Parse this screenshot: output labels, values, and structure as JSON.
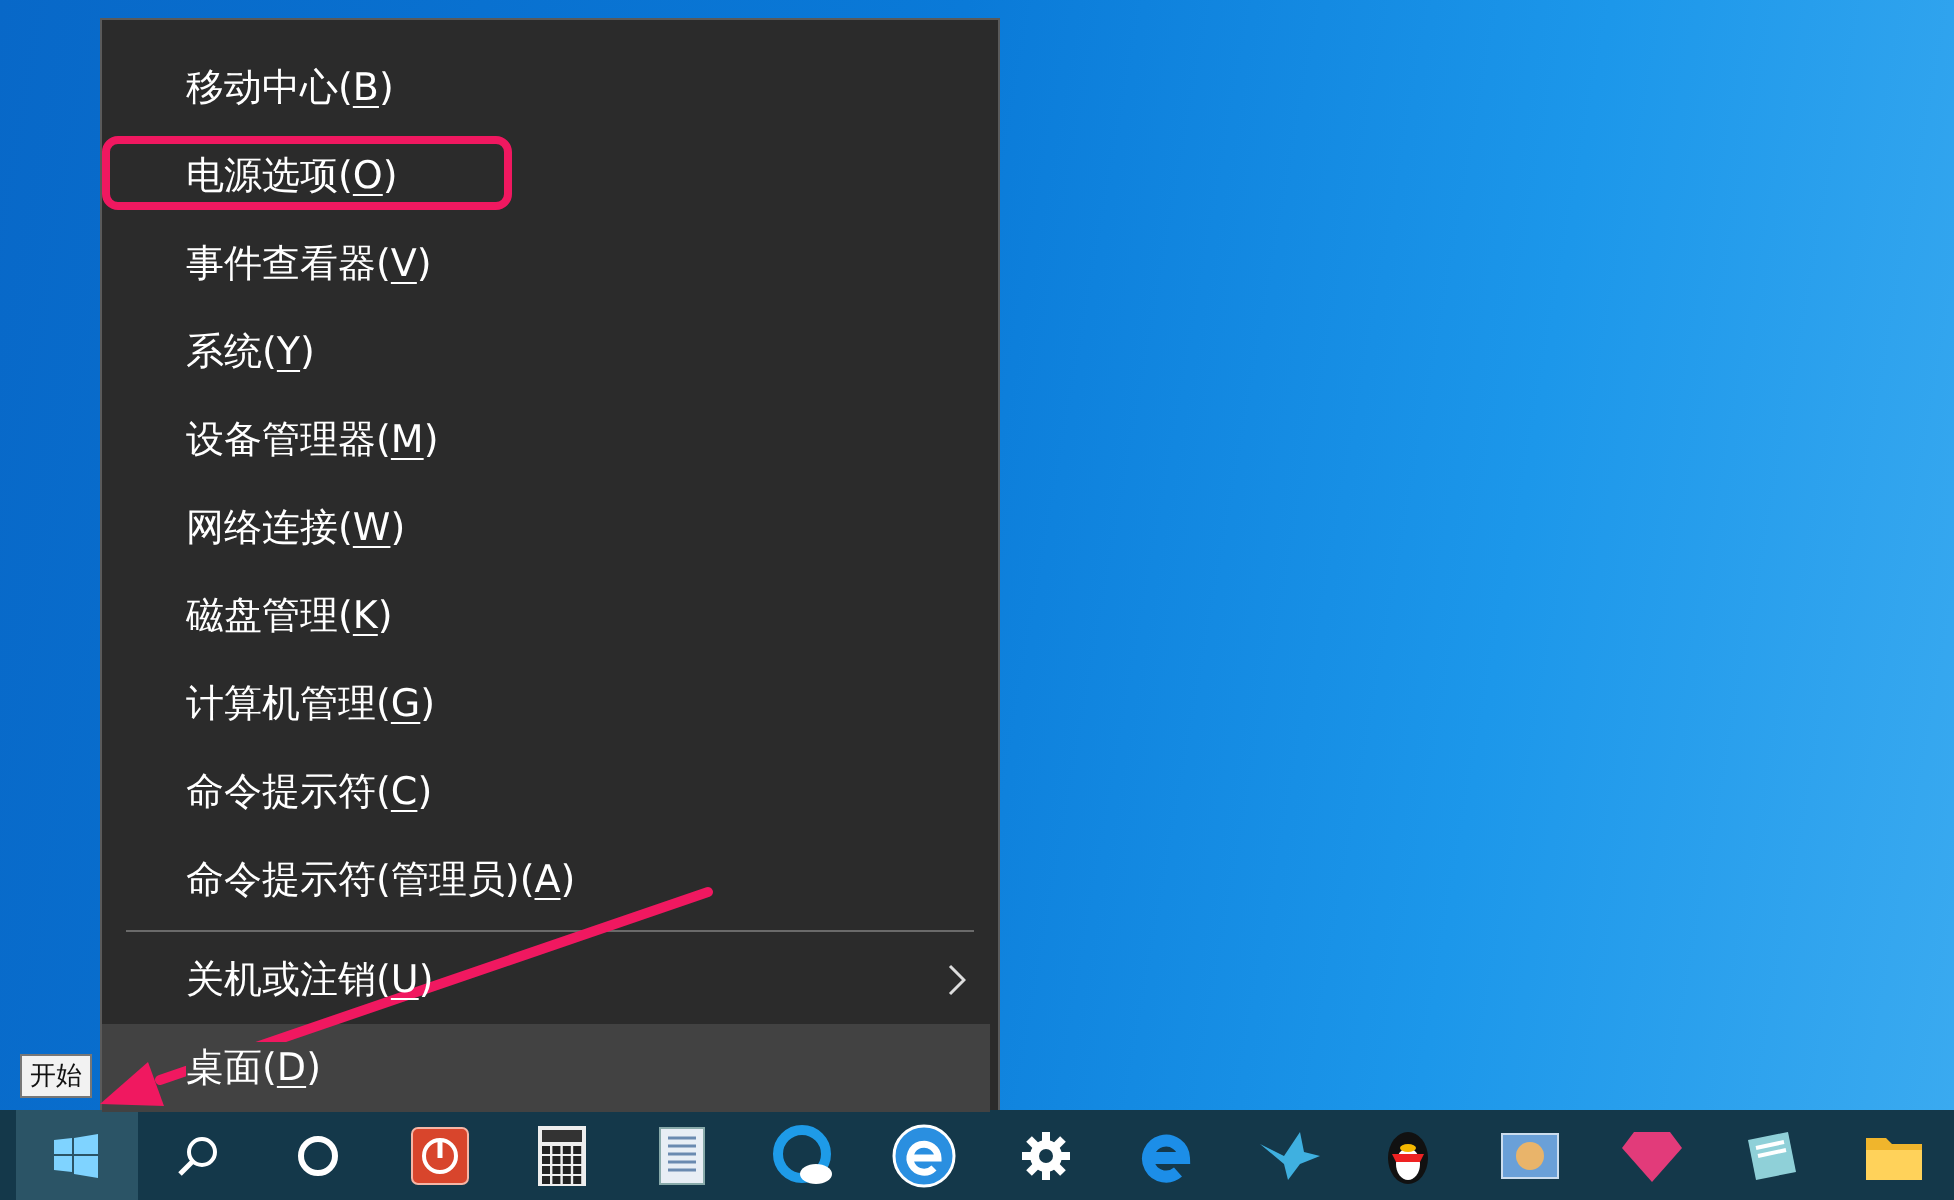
{
  "context_menu": {
    "items": [
      {
        "before": "移动中心(",
        "mnemonic": "B",
        "after": ")",
        "circled": false,
        "selected": false,
        "submenu": false
      },
      {
        "before": "电源选项(",
        "mnemonic": "O",
        "after": ")",
        "circled": true,
        "selected": false,
        "submenu": false
      },
      {
        "before": "事件查看器(",
        "mnemonic": "V",
        "after": ")",
        "circled": false,
        "selected": false,
        "submenu": false
      },
      {
        "before": "系统(",
        "mnemonic": "Y",
        "after": ")",
        "circled": false,
        "selected": false,
        "submenu": false
      },
      {
        "before": "设备管理器(",
        "mnemonic": "M",
        "after": ")",
        "circled": false,
        "selected": false,
        "submenu": false
      },
      {
        "before": "网络连接(",
        "mnemonic": "W",
        "after": ")",
        "circled": false,
        "selected": false,
        "submenu": false
      },
      {
        "before": "磁盘管理(",
        "mnemonic": "K",
        "after": ")",
        "circled": false,
        "selected": false,
        "submenu": false
      },
      {
        "before": "计算机管理(",
        "mnemonic": "G",
        "after": ")",
        "circled": false,
        "selected": false,
        "submenu": false
      },
      {
        "before": "命令提示符(",
        "mnemonic": "C",
        "after": ")",
        "circled": false,
        "selected": false,
        "submenu": false
      },
      {
        "before": "命令提示符(管理员)(",
        "mnemonic": "A",
        "after": ")",
        "circled": false,
        "selected": false,
        "submenu": false
      },
      {
        "kind": "separator"
      },
      {
        "before": "关机或注销(",
        "mnemonic": "U",
        "after": ")",
        "circled": false,
        "selected": false,
        "submenu": true
      },
      {
        "before": "桌面(",
        "mnemonic": "D",
        "after": ")",
        "circled": false,
        "selected": true,
        "submenu": false
      }
    ]
  },
  "tooltip": {
    "text": "开始"
  },
  "taskbar": {
    "buttons": [
      {
        "kind": "start",
        "selected": true
      },
      {
        "kind": "search",
        "selected": false
      },
      {
        "kind": "cortana",
        "selected": false
      },
      {
        "kind": "power",
        "selected": false
      },
      {
        "kind": "calculator",
        "selected": false
      },
      {
        "kind": "notepad",
        "selected": false
      },
      {
        "kind": "cloud",
        "selected": false
      },
      {
        "kind": "ie",
        "selected": false
      },
      {
        "kind": "settings",
        "selected": false
      },
      {
        "kind": "edge",
        "selected": false
      },
      {
        "kind": "bird",
        "selected": false
      },
      {
        "kind": "penguin",
        "selected": false
      },
      {
        "kind": "photo",
        "selected": false
      },
      {
        "kind": "gem",
        "selected": false
      },
      {
        "kind": "note",
        "selected": false
      },
      {
        "kind": "folder",
        "selected": false
      }
    ]
  }
}
